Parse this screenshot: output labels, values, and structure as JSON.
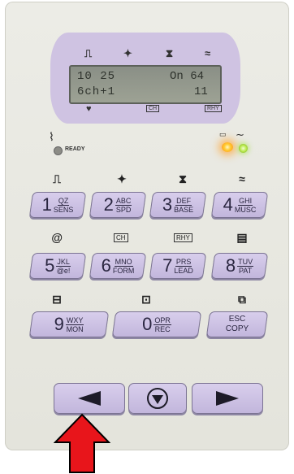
{
  "display": {
    "line1_left": "10  25",
    "line1_right": "On 64",
    "line2_left": "6ch+1",
    "line2_right": "11"
  },
  "top_icons": [
    "pulse-icon",
    "runner-icon",
    "hourglass-icon",
    "wave-icon"
  ],
  "bottom_icons": {
    "heart": "heart-icon",
    "ch_label": "CH",
    "rhy_label": "RHY"
  },
  "status": {
    "ready_label": "READY"
  },
  "row_icons_1": [
    "pulse-icon",
    "runner-icon",
    "hourglass-icon",
    "wave-icon"
  ],
  "row_icons_2": {
    "at": "@",
    "ch": "CH",
    "rhy": "RHY",
    "clipboard": "clipboard-icon"
  },
  "keys": [
    {
      "num": "1",
      "top": "QZ",
      "bottom": "SENS"
    },
    {
      "num": "2",
      "top": "ABC",
      "bottom": "SPD"
    },
    {
      "num": "3",
      "top": "DEF",
      "bottom": "BASE"
    },
    {
      "num": "4",
      "top": "GHI",
      "bottom": "MUSC"
    },
    {
      "num": "5",
      "top": "JKL",
      "bottom": "@e!"
    },
    {
      "num": "6",
      "top": "MNO",
      "bottom": "FORM"
    },
    {
      "num": "7",
      "top": "PRS",
      "bottom": "LEAD"
    },
    {
      "num": "8",
      "top": "TUV",
      "bottom": "PAT"
    },
    {
      "num": "9",
      "top": "WXY",
      "bottom": "MON"
    },
    {
      "num": "0",
      "top": "OPR",
      "bottom": "REC"
    }
  ],
  "esc_key": {
    "top": "ESC",
    "bottom": "COPY"
  },
  "nav": {
    "left": "left-arrow-icon",
    "stop": "stop-icon",
    "right": "right-arrow-icon"
  },
  "indicator": "red-arrow-pointer"
}
